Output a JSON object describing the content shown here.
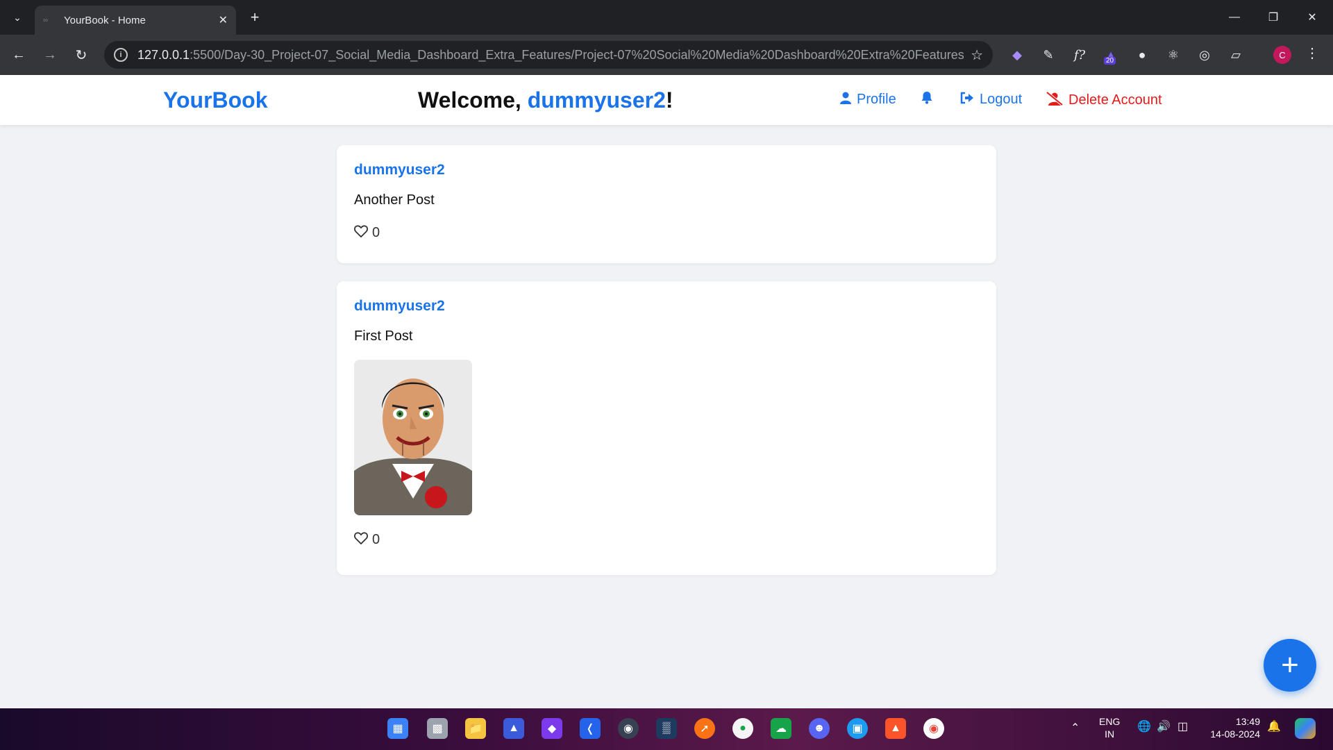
{
  "browser": {
    "tab_title": "YourBook - Home",
    "url_host": "127.0.0.1",
    "url_rest": ":5500/Day-30_Project-07_Social_Media_Dashboard_Extra_Features/Project-07%20Social%20Media%20Dashboard%20Extra%20Features/dashb...",
    "extension_badge": "20",
    "profile_initial": "C"
  },
  "header": {
    "brand": "YourBook",
    "welcome_prefix": "Welcome, ",
    "username": "dummyuser2",
    "welcome_suffix": "!",
    "nav": {
      "profile": "Profile",
      "logout": "Logout",
      "delete_account": "Delete Account"
    }
  },
  "posts": [
    {
      "author": "dummyuser2",
      "content": "Another Post",
      "likes": "0",
      "has_image": false
    },
    {
      "author": "dummyuser2",
      "content": "First Post",
      "likes": "0",
      "has_image": true
    }
  ],
  "colors": {
    "accent": "#1a73e8",
    "danger": "#e31b1b",
    "page_bg": "#f0f2f5"
  },
  "taskbar": {
    "lang_line1": "ENG",
    "lang_line2": "IN",
    "time": "13:49",
    "date": "14-08-2024"
  }
}
